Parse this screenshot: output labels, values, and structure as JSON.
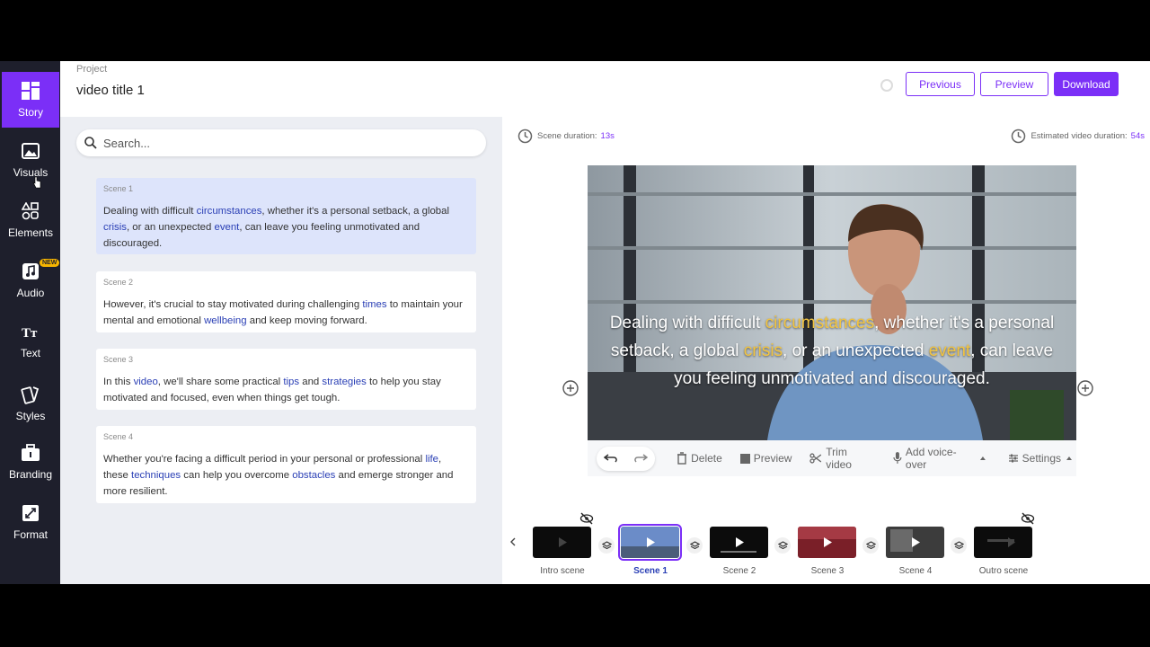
{
  "sidebar": {
    "items": [
      {
        "label": "Story",
        "icon": "dashboard-icon"
      },
      {
        "label": "Visuals",
        "icon": "image-icon"
      },
      {
        "label": "Elements",
        "icon": "shapes-icon"
      },
      {
        "label": "Audio",
        "icon": "music-icon",
        "badge": "NEW"
      },
      {
        "label": "Text",
        "icon": "text-icon"
      },
      {
        "label": "Styles",
        "icon": "styles-icon"
      },
      {
        "label": "Branding",
        "icon": "briefcase-icon"
      },
      {
        "label": "Format",
        "icon": "resize-icon"
      }
    ],
    "active": "Story"
  },
  "header": {
    "project_label": "Project",
    "title": "video title 1",
    "previous_label": "Previous",
    "preview_label": "Preview",
    "download_label": "Download"
  },
  "story": {
    "search_placeholder": "Search...",
    "scenes": [
      {
        "label": "Scene 1",
        "parts": [
          [
            "Dealing with difficult ",
            false
          ],
          [
            "circumstances",
            true
          ],
          [
            ", whether it's a personal setback, a global ",
            false
          ],
          [
            "crisis",
            true
          ],
          [
            ", or an unexpected ",
            false
          ],
          [
            "event",
            true
          ],
          [
            ", can leave you feeling unmotivated and discouraged.",
            false
          ]
        ]
      },
      {
        "label": "Scene 2",
        "parts": [
          [
            "However, it's crucial to stay motivated during challenging ",
            false
          ],
          [
            "times",
            true
          ],
          [
            " to maintain your mental and emotional ",
            false
          ],
          [
            "wellbeing",
            true
          ],
          [
            " and keep moving forward.",
            false
          ]
        ]
      },
      {
        "label": "Scene 3",
        "parts": [
          [
            "In this ",
            false
          ],
          [
            "video",
            true
          ],
          [
            ", we'll share some practical ",
            false
          ],
          [
            "tips",
            true
          ],
          [
            " and ",
            false
          ],
          [
            "strategies",
            true
          ],
          [
            " to help you stay motivated and focused, even when things get tough.",
            false
          ]
        ]
      },
      {
        "label": "Scene 4",
        "parts": [
          [
            "Whether you're facing a difficult period in your personal or professional ",
            false
          ],
          [
            "life",
            true
          ],
          [
            ", these ",
            false
          ],
          [
            "techniques",
            true
          ],
          [
            " can help you overcome ",
            false
          ],
          [
            "obstacles",
            true
          ],
          [
            " and emerge stronger and more resilient.",
            false
          ]
        ]
      }
    ]
  },
  "preview": {
    "scene_duration_label": "Scene duration:",
    "scene_duration_value": "13s",
    "estimated_label": "Estimated video duration:",
    "estimated_value": "54s",
    "caption_parts": [
      [
        "Dealing with difficult ",
        false
      ],
      [
        "circumstances",
        true
      ],
      [
        ", whether it's a personal setback, a global ",
        false
      ],
      [
        "crisis",
        true
      ],
      [
        ", or an unexpected ",
        false
      ],
      [
        "event",
        true
      ],
      [
        ", can leave you feeling unmotivated and discouraged.",
        false
      ]
    ],
    "toolbar": {
      "delete": "Delete",
      "preview": "Preview",
      "trim": "Trim video",
      "voiceover": "Add voice-over",
      "settings": "Settings"
    }
  },
  "timeline": {
    "scenes": [
      "Intro scene",
      "Scene 1",
      "Scene 2",
      "Scene 3",
      "Scene 4",
      "Outro scene"
    ],
    "active": "Scene 1"
  },
  "colors": {
    "accent": "#7b2ff7",
    "sidebar_bg": "#1e1f2c",
    "keyword": "#2a3fb5",
    "caption_highlight": "#f2c440"
  }
}
